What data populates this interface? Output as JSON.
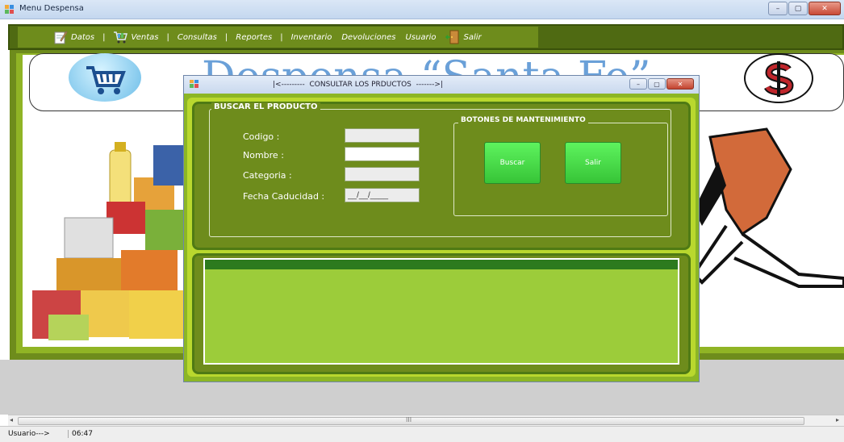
{
  "window": {
    "title": "Menu Despensa",
    "buttons": {
      "minimize": "–",
      "maximize": "▢",
      "close": "✕"
    }
  },
  "menu": {
    "items": [
      {
        "label": "Datos",
        "icon": "notepad-icon"
      },
      {
        "label": "Ventas",
        "icon": "cart-icon"
      },
      {
        "label": "Consultas"
      },
      {
        "label": "Reportes"
      },
      {
        "label": "Inventario"
      },
      {
        "label": "Devoluciones"
      },
      {
        "label": "Usuario"
      },
      {
        "label": "Salir",
        "icon": "door-exit-icon"
      }
    ],
    "separator": "|"
  },
  "banner": {
    "text": "Despensa “Santa Fe”"
  },
  "dialog": {
    "title": "|<---------  CONSULTAR LOS PRDUCTOS  ------->|",
    "buttons": {
      "minimize": "–",
      "maximize": "▢",
      "close": "✕"
    },
    "search_group": {
      "legend": "BUSCAR EL PRODUCTO",
      "fields": [
        {
          "label": "Codigo :",
          "value": "",
          "enabled": false
        },
        {
          "label": "Nombre :",
          "value": "",
          "enabled": true
        },
        {
          "label": "Categoria :",
          "value": "",
          "enabled": false
        },
        {
          "label": "Fecha Caducidad :",
          "value": "__/__/____",
          "enabled": false
        }
      ]
    },
    "maintenance_group": {
      "legend": "BOTONES DE MANTENIMIENTO",
      "buscar_label": "Buscar",
      "salir_label": "Salir"
    }
  },
  "scrollbar": {
    "thumb_glyph": "III",
    "left": "◂",
    "right": "▸"
  },
  "status": {
    "user": "Usuario--->",
    "time": "06:47"
  },
  "colors": {
    "menu_green": "#6e8c1c",
    "panel_green": "#8cb625",
    "button_green": "#48d948"
  }
}
